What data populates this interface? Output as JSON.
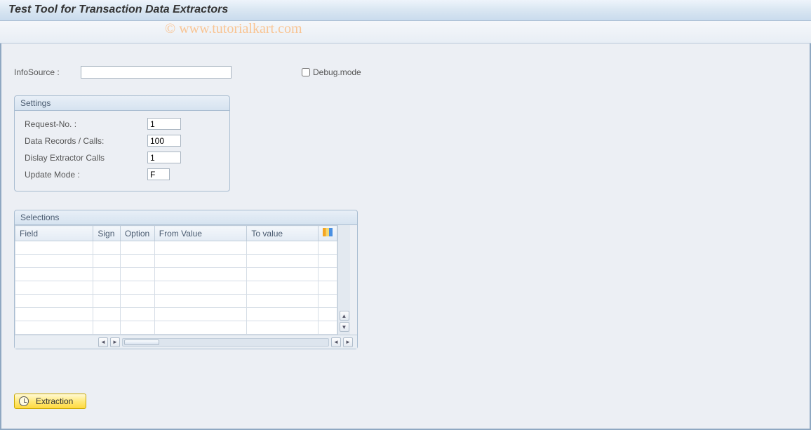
{
  "header": {
    "title": "Test Tool for Transaction Data Extractors"
  },
  "watermark": "© www.tutorialkart.com",
  "form": {
    "infosource_label": "InfoSource :",
    "infosource_value": "",
    "debug_label": "Debug.mode",
    "debug_checked": false
  },
  "settings": {
    "title": "Settings",
    "rows": [
      {
        "label": "Request-No. :",
        "value": "1"
      },
      {
        "label": "Data Records / Calls:",
        "value": "100"
      },
      {
        "label": "Dislay Extractor Calls",
        "value": "1"
      },
      {
        "label": "Update Mode :",
        "value": "F"
      }
    ]
  },
  "selections": {
    "title": "Selections",
    "columns": [
      "Field",
      "Sign",
      "Option",
      "From Value",
      "To value"
    ],
    "rows": [
      [
        "",
        "",
        "",
        "",
        ""
      ],
      [
        "",
        "",
        "",
        "",
        ""
      ],
      [
        "",
        "",
        "",
        "",
        ""
      ],
      [
        "",
        "",
        "",
        "",
        ""
      ],
      [
        "",
        "",
        "",
        "",
        ""
      ],
      [
        "",
        "",
        "",
        "",
        ""
      ],
      [
        "",
        "",
        "",
        "",
        ""
      ]
    ]
  },
  "buttons": {
    "extraction": "Extraction"
  }
}
